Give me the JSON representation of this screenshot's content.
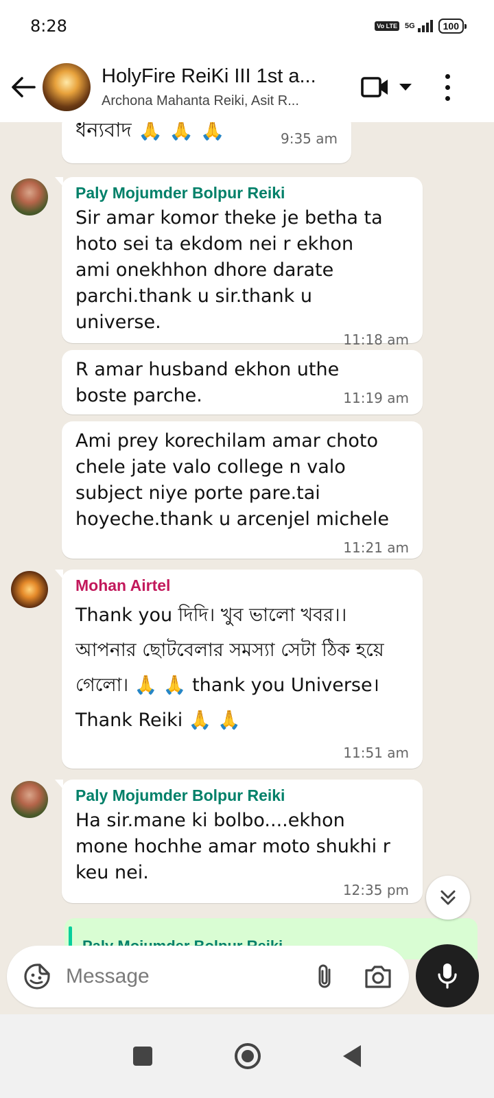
{
  "status_bar": {
    "time": "8:28",
    "volte": "Vo LTE",
    "network": "5G",
    "battery": "100"
  },
  "header": {
    "title": "HolyFire ReiKi III 1st a...",
    "members": "Archona Mahanta Reiki, Asit R..."
  },
  "messages": [
    {
      "text": "ধন্যবাদ 🙏 🙏 🙏",
      "time": "9:35 am"
    },
    {
      "sender": "Paly Mojumder Bolpur Reiki",
      "text": "Sir amar komor theke je betha ta hoto sei ta ekdom nei r ekhon ami onekhhon dhore darate parchi.thank u sir.thank u universe.",
      "time": "11:18 am"
    },
    {
      "text": "R amar husband ekhon uthe boste parche.",
      "time": "11:19 am"
    },
    {
      "text": "Ami prey korechilam amar choto chele jate valo college n valo subject niye porte pare.tai hoyeche.thank u arcenjel michele",
      "time": "11:21 am"
    },
    {
      "sender": "Mohan Airtel",
      "text": "Thank you দিদি। খুব ভালো খবর।। আপনার ছোটবেলার সমস্যা সেটা ঠিক হয়ে গেলো। 🙏 🙏 thank you Universe। Thank Reiki 🙏 🙏",
      "time": "11:51 am"
    },
    {
      "sender": "Paly Mojumder Bolpur Reiki",
      "text": "Ha sir.mane ki bolbo....ekhon mone hochhe amar moto shukhi r keu nei.",
      "time": "12:35 pm"
    }
  ],
  "reply_preview": {
    "name": "Paly Mojumder Bolpur Reiki"
  },
  "composer": {
    "placeholder": "Message"
  },
  "colors": {
    "sender_teal": "#008069",
    "sender_red": "#c2185b",
    "chat_bg": "#efeae2",
    "bubble": "#ffffff",
    "mic_bg": "#1f1f1f"
  },
  "icons": [
    "back-arrow-icon",
    "video-call-icon",
    "dropdown-icon",
    "more-options-icon",
    "sticker-icon",
    "attach-icon",
    "camera-icon",
    "mic-icon",
    "chevron-double-down-icon"
  ]
}
